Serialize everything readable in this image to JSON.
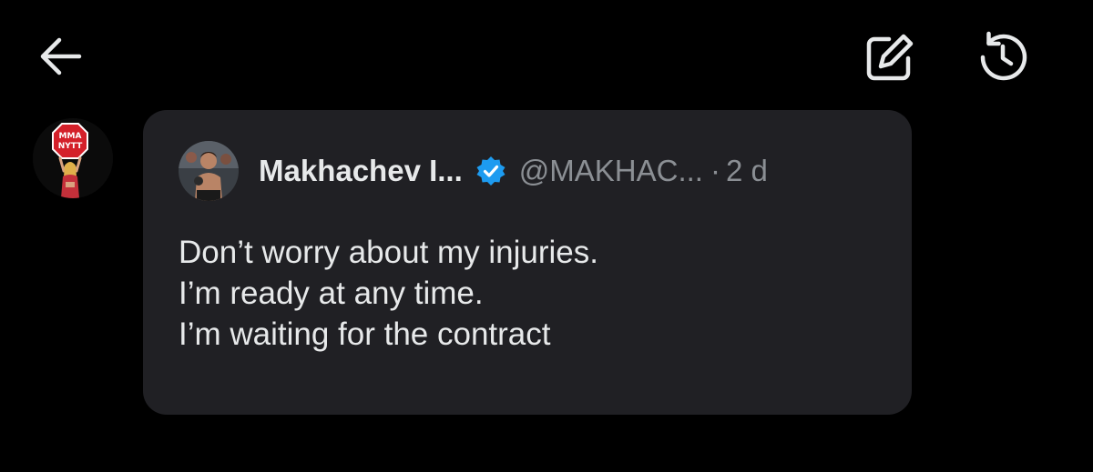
{
  "topbar": {
    "back_icon": "arrow-left-icon",
    "edit_icon": "edit-icon",
    "history_icon": "history-icon",
    "icon_color": "#e7e9ea"
  },
  "message": {
    "sender_avatar_text": "MMA NYTT",
    "bubble_color": "#202024",
    "quoted_post": {
      "display_name": "Makhachev I...",
      "verified_icon": "verified-badge-icon",
      "verified_color": "#1d9bf0",
      "handle": "@MAKHAC...",
      "separator": "·",
      "time": "2 d",
      "text_lines": [
        "Don’t worry about my injuries.",
        "I’m ready at any time.",
        "I’m waiting for the contract"
      ]
    }
  }
}
